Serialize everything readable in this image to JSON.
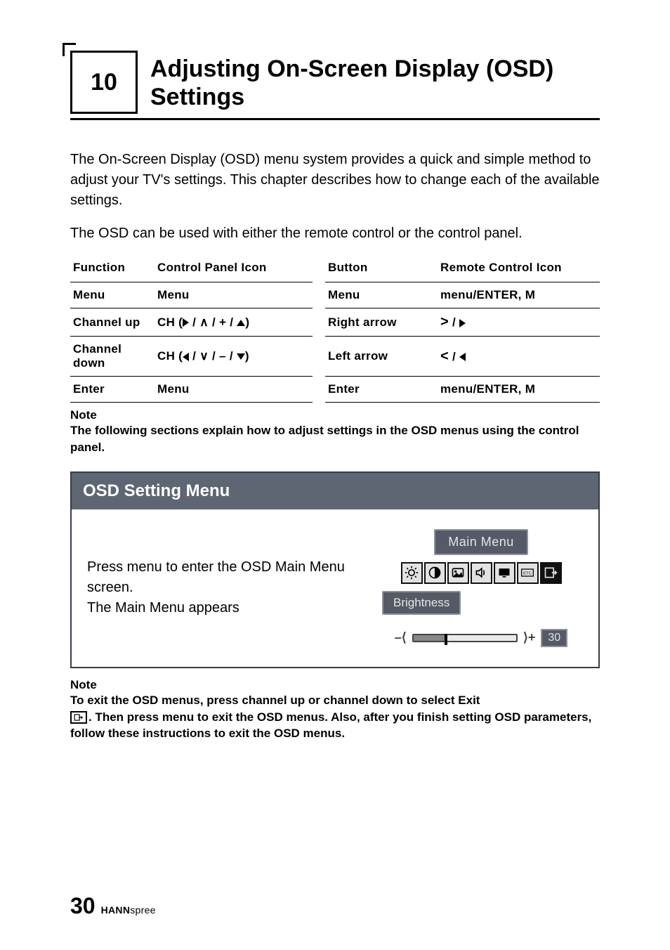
{
  "chapter": {
    "number": "10",
    "title": "Adjusting On-Screen Display (OSD) Settings"
  },
  "intro": {
    "p1": "The On-Screen Display (OSD) menu system provides a quick and simple method to adjust your TV's settings. This chapter describes how to change each of the available settings.",
    "p2": "The OSD can be used with either the remote control or the control panel."
  },
  "table": {
    "headers": {
      "function": "Function",
      "panel_icon": "Control Panel Icon",
      "button": "Button",
      "remote_icon": "Remote Control Icon"
    },
    "rows": [
      {
        "function": "Menu",
        "panel_icon": "Menu",
        "button": "Menu",
        "remote_icon": "menu/ENTER, M"
      },
      {
        "function": "Channel up",
        "panel_icon_prefix": "CH (",
        "panel_icon_mid1": " / ",
        "panel_icon_mid2": " / + / ",
        "panel_icon_suffix": ")",
        "button": "Right arrow",
        "remote_icon_mid": " / "
      },
      {
        "function": "Channel down",
        "panel_icon_prefix": "CH (",
        "panel_icon_mid1": " / ",
        "panel_icon_mid2": " / – / ",
        "panel_icon_suffix": ")",
        "button": "Left arrow",
        "remote_icon_mid": " / "
      },
      {
        "function": "Enter",
        "panel_icon": "Menu",
        "button": "Enter",
        "remote_icon": "menu/ENTER, M"
      }
    ]
  },
  "note1": {
    "label": "Note",
    "body": "The following sections explain how to adjust settings in the OSD menus using the control panel."
  },
  "section": {
    "header": "OSD Setting Menu",
    "body_line1": "Press menu to enter the OSD Main Menu screen.",
    "body_line2": "The Main Menu appears",
    "osd": {
      "title": "Main  Menu",
      "label": "Brightness",
      "value": "30"
    }
  },
  "note2": {
    "label": "Note",
    "line1": "To exit the OSD menus, press channel up or channel down to select Exit",
    "line2_after_icon": ". Then press menu to exit the OSD menus. Also, after you finish setting OSD parameters, follow these instructions to exit the OSD menus."
  },
  "footer": {
    "page": "30",
    "brand_bold": "HANN",
    "brand_rest": "spree"
  },
  "glyph": {
    "gt": ">",
    "lt": "<",
    "and": "∧",
    "or": "∨"
  }
}
